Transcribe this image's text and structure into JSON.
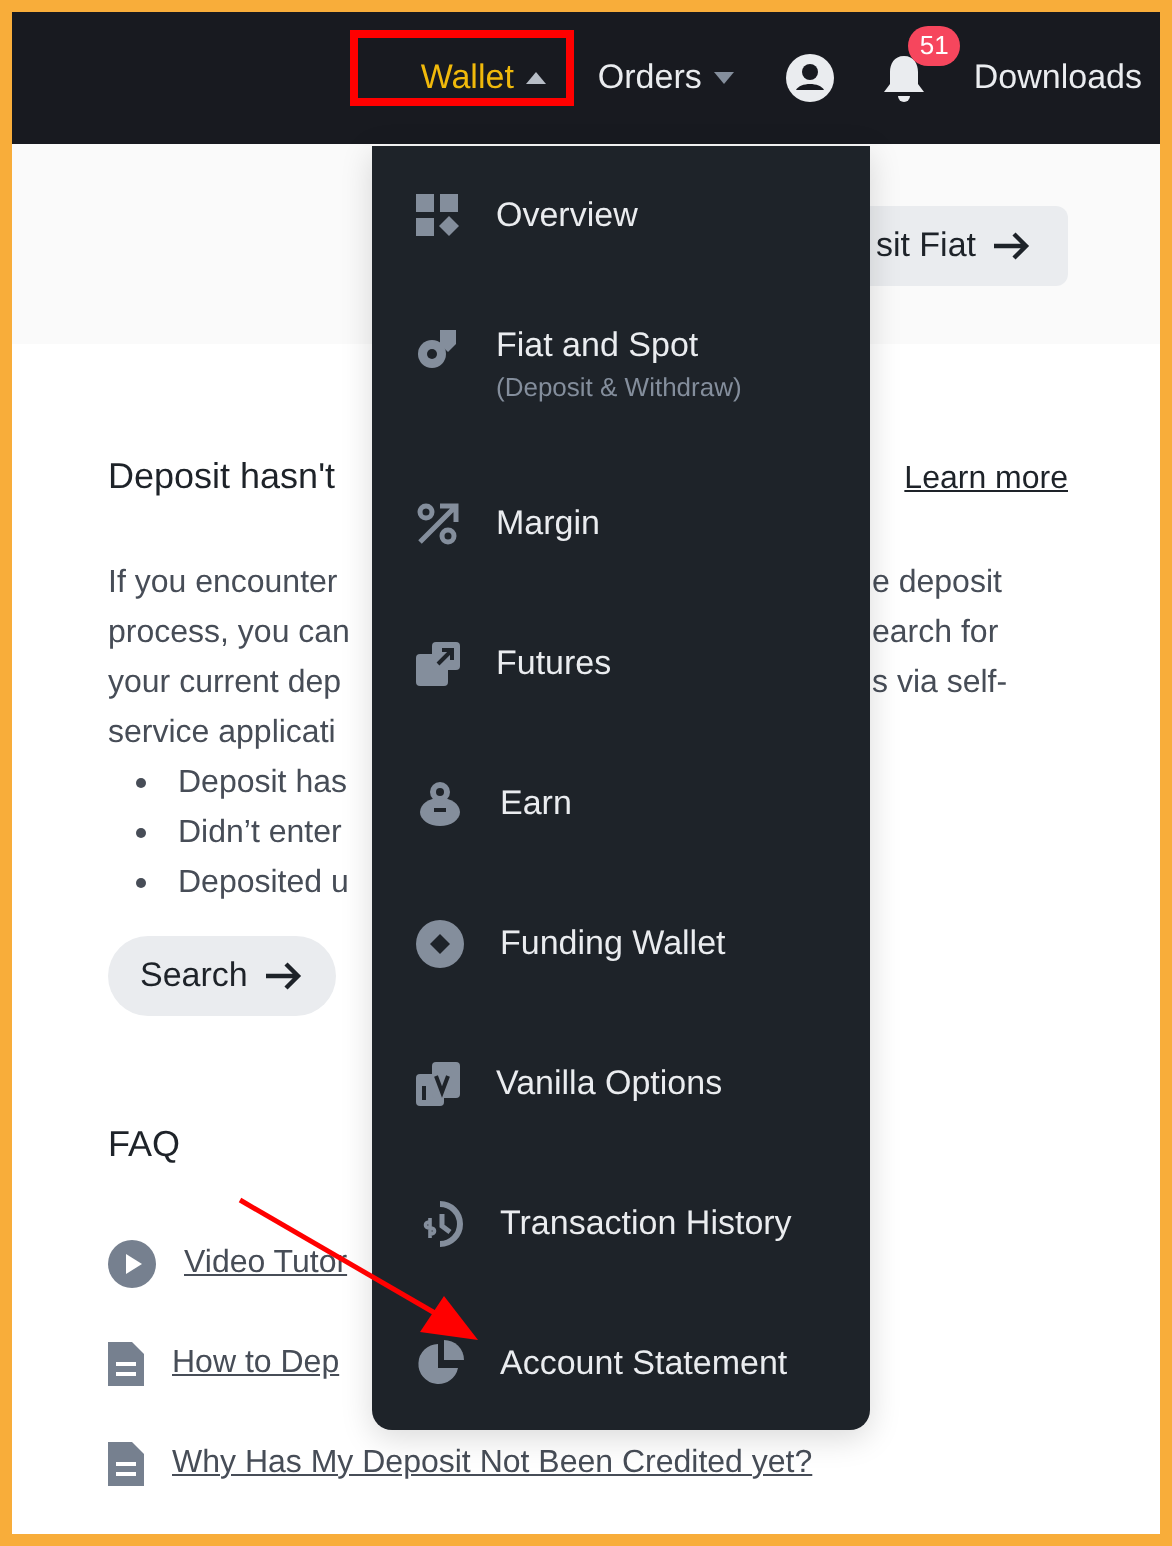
{
  "nav": {
    "items": [
      {
        "kind": "menu",
        "label": "Wallet",
        "selected": true
      },
      {
        "kind": "menu",
        "label": "Orders",
        "selected": false
      },
      {
        "kind": "account"
      },
      {
        "kind": "notifications",
        "badge": "51"
      },
      {
        "kind": "link",
        "label": "Downloads"
      }
    ]
  },
  "wallet_menu": {
    "items": [
      {
        "label": "Overview"
      },
      {
        "label": "Fiat and Spot",
        "sublabel": "(Deposit & Withdraw)"
      },
      {
        "label": "Margin"
      },
      {
        "label": "Futures"
      },
      {
        "label": "Earn"
      },
      {
        "label": "Funding Wallet"
      },
      {
        "label": "Vanilla Options"
      },
      {
        "label": "Transaction History"
      },
      {
        "label": "Account Statement"
      }
    ]
  },
  "banner": {
    "button": "sit Fiat"
  },
  "notice": {
    "title": "Deposit hasn't",
    "link": "Learn more",
    "lines": [
      {
        "left": "If you encounter",
        "right": "e deposit"
      },
      {
        "left": "process, you can",
        "right": "earch for"
      },
      {
        "left": "your current dep",
        "right": "s via self-"
      },
      {
        "left": "service applicati"
      }
    ],
    "bullets": [
      "Deposit has",
      "Didn’t enter",
      "Deposited u"
    ],
    "button": "Search"
  },
  "faq": {
    "title": "FAQ",
    "items": [
      {
        "kind": "video",
        "label": "Video Tutor"
      },
      {
        "kind": "article",
        "label": "How to Dep"
      },
      {
        "kind": "article",
        "label": "Why Has My Deposit Not Been Credited yet?"
      }
    ]
  }
}
